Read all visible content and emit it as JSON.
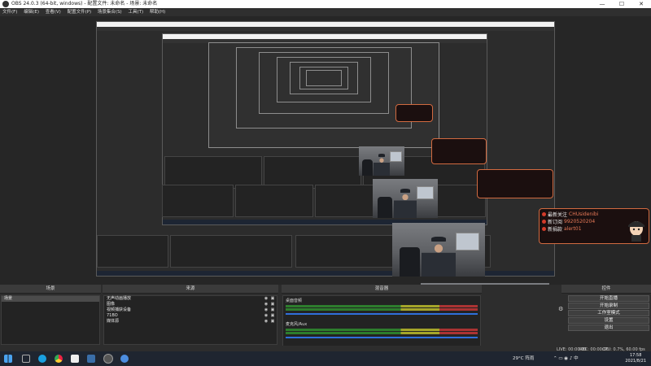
{
  "window": {
    "title": "OBS 24.0.3 (64-bit, windows) - 配置文件: 未命名 - 场景: 未命名",
    "minimize": "—",
    "maximize": "☐",
    "close": "✕"
  },
  "menu": {
    "items": [
      "文件(F)",
      "编辑(E)",
      "查看(V)",
      "配置文件(P)",
      "场景集合(S)",
      "工具(T)",
      "帮助(H)"
    ]
  },
  "alert": {
    "rows": [
      {
        "label": "最新关注",
        "value": "CHUsidenibi"
      },
      {
        "label": "新订阅",
        "value": "9920520204"
      },
      {
        "label": "新捐款",
        "value": "alert01"
      }
    ]
  },
  "docks": {
    "scenes": {
      "title": "场景",
      "items": [
        "场景"
      ]
    },
    "sources": {
      "title": "来源",
      "items": [
        "无声动画播放",
        "图像",
        "视频捕获设备",
        "71BO",
        "媒体源"
      ]
    },
    "mixer": {
      "title": "混音器",
      "tracks": [
        {
          "name": "桌面音频"
        },
        {
          "name": "麦克风/Aux"
        }
      ]
    },
    "controls": {
      "title": "控件",
      "buttons": [
        "开始直播",
        "开始录制",
        "工作室模式",
        "设置",
        "退出"
      ]
    }
  },
  "status": {
    "live": "LIVE: 00:00:00",
    "rec": "REC: 00:00:00",
    "cpu": "CPU: 0.7%, 60.00 fps"
  },
  "taskbar": {
    "weather": "29°C 阵雨",
    "time": "17:58",
    "date": "2021/8/21"
  },
  "colors": {
    "accent_orange": "#d16a40",
    "mixer_green": "#2d7d2d",
    "mixer_blue": "#2f6fdb",
    "taskbar": "#1f2530"
  }
}
